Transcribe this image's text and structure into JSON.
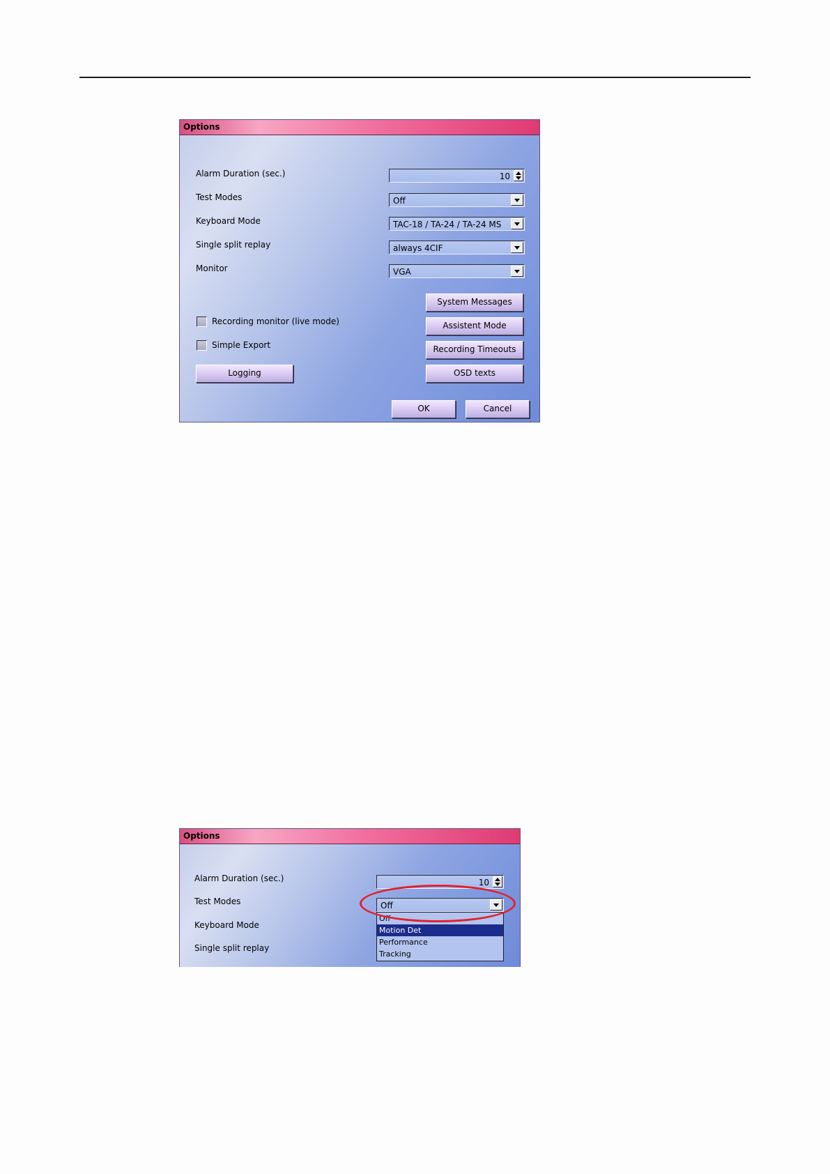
{
  "dialog1": {
    "title": "Options",
    "alarm_duration": {
      "label": "Alarm Duration (sec.)",
      "value": "10"
    },
    "test_modes": {
      "label": "Test Modes",
      "value": "Off"
    },
    "keyboard_mode": {
      "label": "Keyboard Mode",
      "value": "TAC-18 / TA-24 / TA-24 MS"
    },
    "single_split_replay": {
      "label": "Single split replay",
      "value": "always 4CIF"
    },
    "monitor": {
      "label": "Monitor",
      "value": "VGA"
    },
    "recording_monitor_label": "Recording monitor (live mode)",
    "simple_export_label": "Simple Export",
    "buttons": {
      "system_messages": "System Messages",
      "assistent_mode": "Assistent Mode",
      "recording_timeouts": "Recording Timeouts",
      "osd_texts": "OSD texts",
      "logging": "Logging",
      "ok": "OK",
      "cancel": "Cancel"
    }
  },
  "dialog2": {
    "title": "Options",
    "alarm_duration": {
      "label": "Alarm Duration (sec.)",
      "value": "10"
    },
    "test_modes": {
      "label": "Test Modes",
      "value": "Off",
      "options": [
        "Off",
        "Motion Det",
        "Performance",
        "Tracking"
      ],
      "highlighted": "Motion Det"
    },
    "keyboard_mode_label": "Keyboard Mode",
    "single_split_replay_label": "Single split replay"
  },
  "colors": {
    "highlight_oval": "#e0222c",
    "selected_option_bg": "#1c2c8c"
  }
}
